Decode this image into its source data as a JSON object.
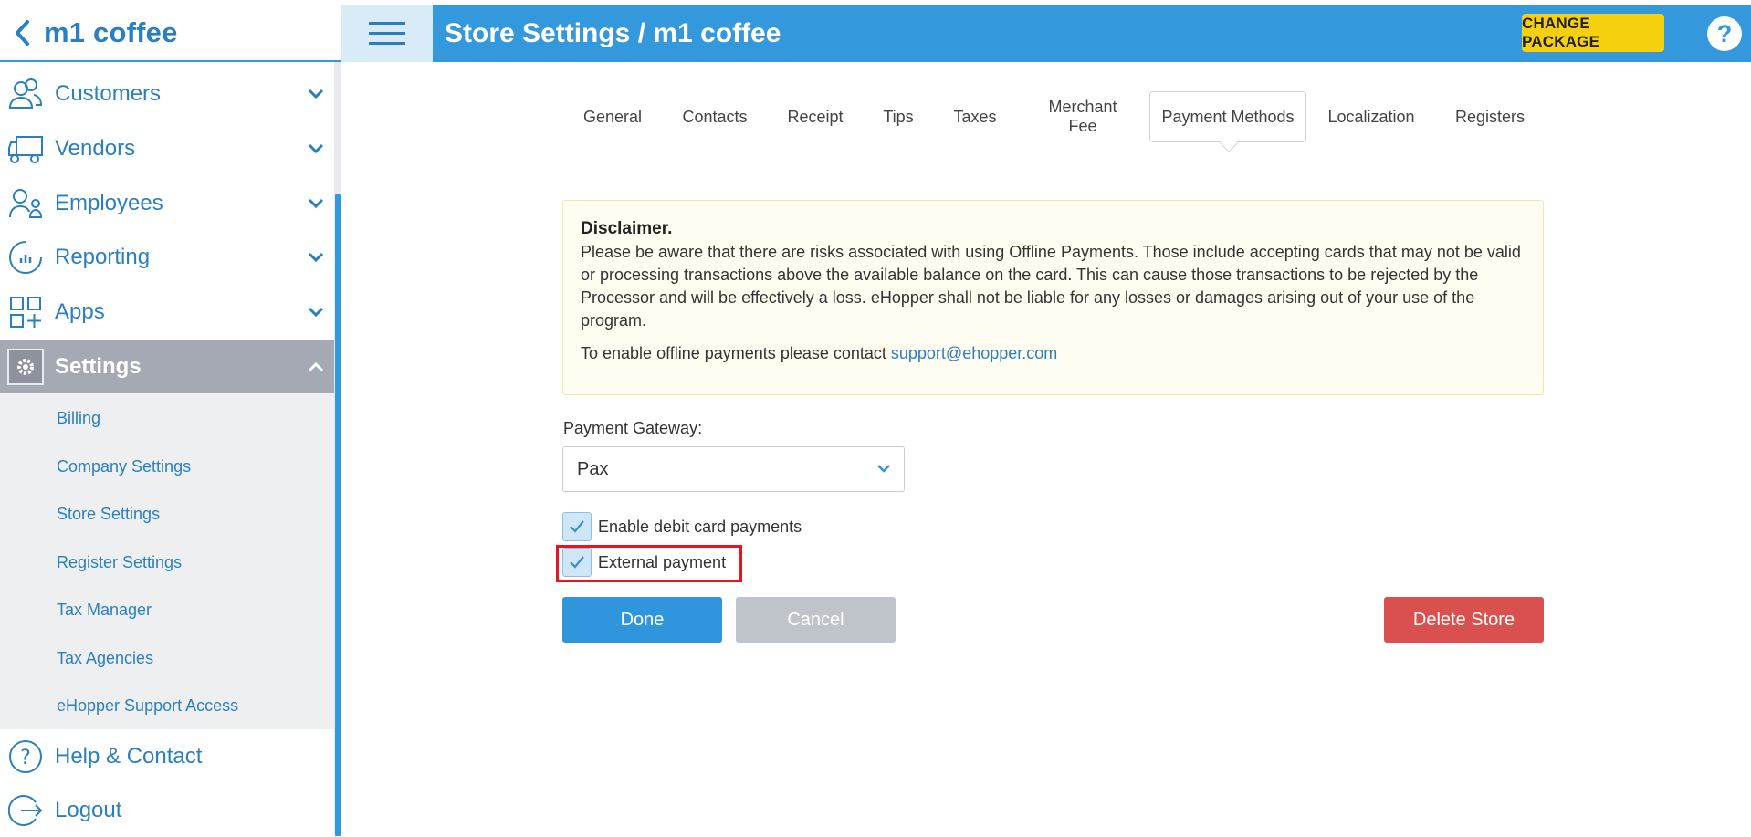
{
  "sidebar": {
    "title": "m1 coffee",
    "items": [
      {
        "label": "Customers",
        "icon": "customers-icon"
      },
      {
        "label": "Vendors",
        "icon": "truck-icon"
      },
      {
        "label": "Employees",
        "icon": "employees-icon"
      },
      {
        "label": "Reporting",
        "icon": "reporting-icon"
      },
      {
        "label": "Apps",
        "icon": "apps-icon"
      },
      {
        "label": "Settings",
        "icon": "gear-icon"
      }
    ],
    "settings_submenu": [
      "Billing",
      "Company Settings",
      "Store Settings",
      "Register Settings",
      "Tax Manager",
      "Tax Agencies",
      "eHopper Support Access"
    ],
    "help_label": "Help & Contact",
    "logout_label": "Logout"
  },
  "header": {
    "title": "Store Settings / m1 coffee",
    "change_package": "CHANGE PACKAGE",
    "help": "?"
  },
  "tabs": [
    {
      "label": "General"
    },
    {
      "label": "Contacts"
    },
    {
      "label": "Receipt"
    },
    {
      "label": "Tips"
    },
    {
      "label": "Taxes"
    },
    {
      "label": "Merchant Fee"
    },
    {
      "label": "Payment Methods",
      "active": true
    },
    {
      "label": "Localization"
    },
    {
      "label": "Registers"
    }
  ],
  "disclaimer": {
    "title": "Disclaimer.",
    "body": "Please be aware that there are risks associated with using Offline Payments. Those include accepting cards that may not be valid or processing transactions above the available balance on the card. This can cause those transactions to be rejected by the Processor and will be effectively a loss. eHopper shall not be liable for any losses or damages arising out of your use of the program.",
    "contact_prefix": "To enable offline payments please contact ",
    "contact_email": "support@ehopper.com"
  },
  "form": {
    "gateway_label": "Payment Gateway:",
    "gateway_value": "Pax",
    "debit_label": "Enable debit card payments",
    "debit_checked": true,
    "external_label": "External payment",
    "external_checked": true
  },
  "buttons": {
    "done": "Done",
    "cancel": "Cancel",
    "delete": "Delete Store"
  },
  "colors": {
    "brand_blue": "#3398dc",
    "warning_yellow": "#f6cf0f",
    "danger_red": "#d9504f",
    "highlight_red": "#e8141e"
  }
}
